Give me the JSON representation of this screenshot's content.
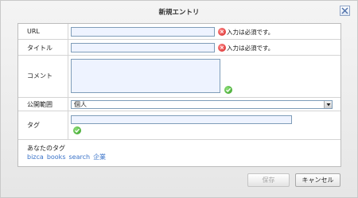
{
  "dialog": {
    "title": "新規エントリ"
  },
  "form": {
    "url": {
      "label": "URL",
      "value": "",
      "error": "入力は必須です。"
    },
    "title": {
      "label": "タイトル",
      "value": "",
      "error": "入力は必須です。"
    },
    "comment": {
      "label": "コメント",
      "value": ""
    },
    "visibility": {
      "label": "公開範囲",
      "selected": "個人"
    },
    "tags": {
      "label": "タグ",
      "value": ""
    },
    "your_tags": {
      "label": "あなたのタグ",
      "items": [
        "bizca",
        "books",
        "search",
        "企業"
      ]
    }
  },
  "buttons": {
    "save": "保存",
    "cancel": "キャンセル"
  },
  "colors": {
    "field_bg": "#eef3ff",
    "tag_link": "#3a73c9",
    "error": "#d42323",
    "ok": "#2f9a1f"
  }
}
